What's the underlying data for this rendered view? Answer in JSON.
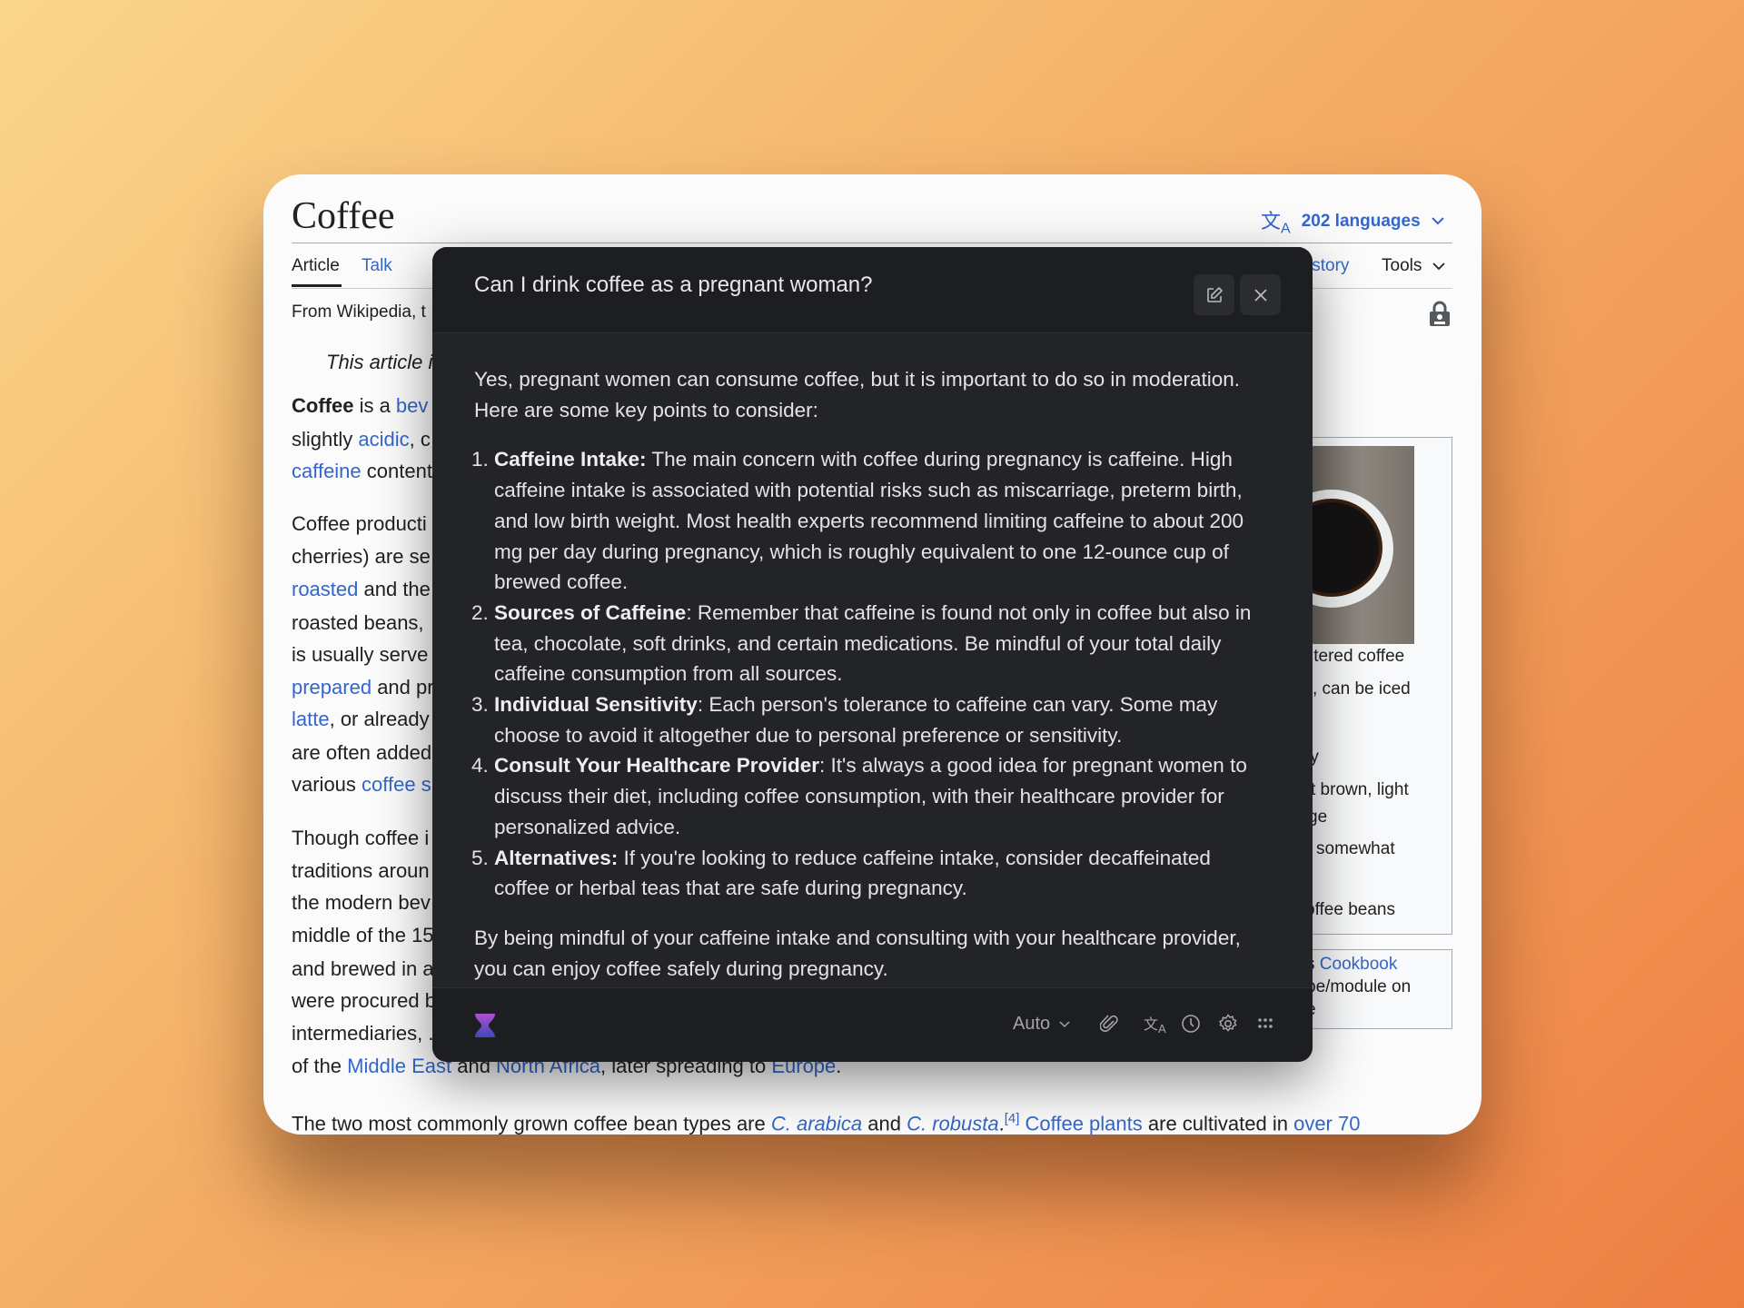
{
  "article": {
    "title": "Coffee",
    "languages": "202 languages",
    "tabs": {
      "article": "Article",
      "talk": "Talk",
      "history": "istory",
      "tools": "Tools"
    },
    "from": "From Wikipedia, t",
    "hatnote": "This article i",
    "lines": [
      [
        {
          "t": "Coffee",
          "b": true
        },
        {
          "t": " is a "
        },
        {
          "t": "bev",
          "l": true
        }
      ],
      [
        {
          "t": "slightly "
        },
        {
          "t": "acidic",
          "l": true
        },
        {
          "t": ", c"
        }
      ],
      [
        {
          "t": "caffeine",
          "l": true
        },
        {
          "t": " content"
        }
      ],
      [
        {
          "t": "Coffee producti"
        }
      ],
      [
        {
          "t": "cherries) are se"
        }
      ],
      [
        {
          "t": "roasted",
          "l": true
        },
        {
          "t": " and the"
        }
      ],
      [
        {
          "t": "roasted beans,"
        }
      ],
      [
        {
          "t": "is usually serve"
        }
      ],
      [
        {
          "t": "prepared",
          "l": true
        },
        {
          "t": " and pr"
        }
      ],
      [
        {
          "t": "latte",
          "l": true
        },
        {
          "t": ", or already"
        }
      ],
      [
        {
          "t": "are often added"
        }
      ],
      [
        {
          "t": "various "
        },
        {
          "t": "coffee s",
          "l": true
        }
      ],
      [
        {
          "t": "Though coffee i"
        }
      ],
      [
        {
          "t": "traditions aroun"
        }
      ],
      [
        {
          "t": "the modern bev"
        }
      ],
      [
        {
          "t": "middle of the 15"
        }
      ],
      [
        {
          "t": "and brewed in a"
        }
      ],
      [
        {
          "t": "were procured b"
        }
      ],
      [
        {
          "t": "intermediaries, ."
        }
      ],
      [
        {
          "t": "of the "
        },
        {
          "t": "Middle East",
          "l": true
        },
        {
          "t": " and "
        },
        {
          "t": "North Africa",
          "l": true
        },
        {
          "t": ", later spreading to "
        },
        {
          "t": "Europe",
          "l": true
        },
        {
          "t": "."
        }
      ]
    ],
    "last_line": [
      {
        "t": "The two most commonly grown coffee bean types are "
      },
      {
        "t": "C. arabica",
        "l": true,
        "i": true
      },
      {
        "t": " and "
      },
      {
        "t": "C. robusta",
        "l": true,
        "i": true
      },
      {
        "t": "."
      },
      {
        "t": "[4]",
        "l": true,
        "sup": true
      },
      {
        "t": " "
      },
      {
        "t": "Coffee plants",
        "l": true
      },
      {
        "t": " are cultivated in "
      },
      {
        "t": "over 70",
        "l": true
      }
    ],
    "infobox": {
      "caption": "ltered coffee",
      "f1": ", can be iced",
      "f2": "ry",
      "f3": "t brown, light",
      "f4": "ge",
      "f5": "somewhat",
      "f6": "offee beans"
    },
    "cookbox": {
      "a": "s ",
      "cookbook": "Cookbook",
      "b": "pe/module on",
      "c": "e"
    }
  },
  "dialog": {
    "question": "Can I drink coffee as a pregnant woman?",
    "intro": "Yes, pregnant women can consume coffee, but it is important to do so in moderation. Here are some key points to consider:",
    "points": [
      {
        "title": "Caffeine Intake:",
        "text": " The main concern with coffee during pregnancy is caffeine. High caffeine intake is associated with potential risks such as miscarriage, preterm birth, and low birth weight. Most health experts recommend limiting caffeine to about 200 mg per day during pregnancy, which is roughly equivalent to one 12-ounce cup of brewed coffee."
      },
      {
        "title": "Sources of Caffeine",
        "text": ": Remember that caffeine is found not only in coffee but also in tea, chocolate, soft drinks, and certain medications. Be mindful of your total daily caffeine consumption from all sources."
      },
      {
        "title": "Individual Sensitivity",
        "text": ": Each person's tolerance to caffeine can vary. Some may choose to avoid it altogether due to personal preference or sensitivity."
      },
      {
        "title": "Consult Your Healthcare Provider",
        "text": ": It's always a good idea for pregnant women to discuss their diet, including coffee consumption, with their healthcare provider for personalized advice."
      },
      {
        "title": "Alternatives:",
        "text": " If you're looking to reduce caffeine intake, consider decaffeinated coffee or herbal teas that are safe during pregnancy."
      }
    ],
    "conclusion": "By being mindful of your caffeine intake and consulting with your healthcare provider, you can enjoy coffee safely during pregnancy.",
    "footer": {
      "model": "Auto"
    }
  },
  "colors": {
    "link": "#3366cc",
    "dialog_bg": "#232428",
    "accent_logo": "#8a4fd0"
  }
}
